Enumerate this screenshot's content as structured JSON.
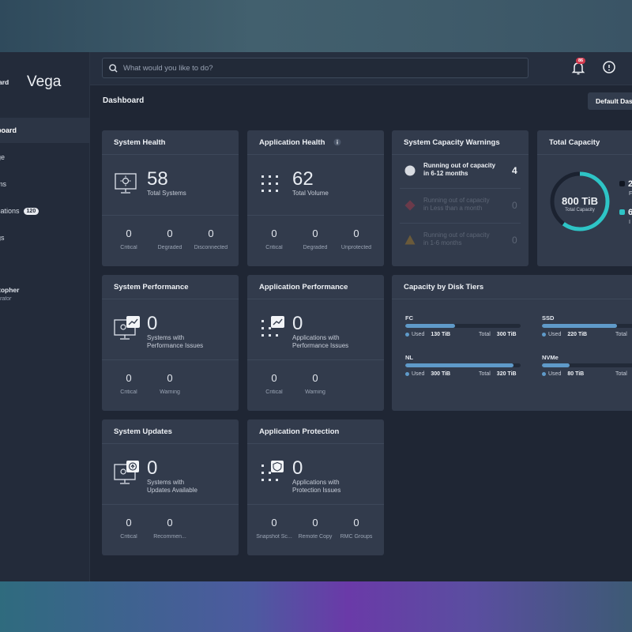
{
  "sidebar": {
    "brand_small": "ard",
    "brand": "Vega",
    "items": [
      {
        "label": "board",
        "active": true
      },
      {
        "label": "ge"
      },
      {
        "label": "ms"
      },
      {
        "label": "cations",
        "badge": "120"
      },
      {
        "label": "gs"
      }
    ],
    "user": {
      "name": "topher",
      "role": "trator"
    }
  },
  "topbar": {
    "search_placeholder": "What would you like to do?",
    "notification_count": "86"
  },
  "dashboard": {
    "title": "Dashboard",
    "default_button": "Default Das"
  },
  "cards": {
    "system_health": {
      "title": "System Health",
      "value": "58",
      "sub": "Total Systems",
      "stats": [
        {
          "v": "0",
          "l": "Critical"
        },
        {
          "v": "0",
          "l": "Degraded"
        },
        {
          "v": "0",
          "l": "Disconnected"
        }
      ]
    },
    "application_health": {
      "title": "Application Health",
      "value": "62",
      "sub": "Total Volume",
      "stats": [
        {
          "v": "0",
          "l": "Critical"
        },
        {
          "v": "0",
          "l": "Degraded"
        },
        {
          "v": "0",
          "l": "Unprotected"
        }
      ]
    },
    "capacity_warnings": {
      "title": "System Capacity Warnings",
      "rows": [
        {
          "line1": "Running out of capacity",
          "line2": "in 6-12 months",
          "count": "4"
        },
        {
          "line1": "Running out of capacity",
          "line2": "in Less than a month",
          "count": "0"
        },
        {
          "line1": "Running out of capacity",
          "line2": "in 1-6 months",
          "count": "0"
        }
      ]
    },
    "total_capacity": {
      "title": "Total Capacity",
      "value": "800 TiB",
      "sub": "Total Capacity",
      "used_fraction": 0.6,
      "legend": [
        {
          "value": "2",
          "label": "F"
        },
        {
          "value": "6",
          "label": "I"
        }
      ],
      "colors": {
        "used": "#2ec4c6",
        "free": "#1b2230"
      }
    },
    "system_performance": {
      "title": "System Performance",
      "value": "0",
      "sub1": "Systems with",
      "sub2": "Performance Issues",
      "stats": [
        {
          "v": "0",
          "l": "Critical"
        },
        {
          "v": "0",
          "l": "Warning"
        }
      ]
    },
    "application_performance": {
      "title": "Application Performance",
      "value": "0",
      "sub1": "Applications with",
      "sub2": "Performance Issues",
      "stats": [
        {
          "v": "0",
          "l": "Critical"
        },
        {
          "v": "0",
          "l": "Warning"
        }
      ]
    },
    "disk_tiers": {
      "title": "Capacity by Disk Tiers",
      "tiers": [
        {
          "name": "FC",
          "used": "130 TiB",
          "total": "300 TiB",
          "fraction": 0.43
        },
        {
          "name": "SSD",
          "used": "220 TiB",
          "total": "",
          "fraction": 0.73
        },
        {
          "name": "NL",
          "used": "300 TiB",
          "total": "320 TiB",
          "fraction": 0.94
        },
        {
          "name": "NVMe",
          "used": "80 TiB",
          "total": "",
          "fraction": 0.27
        }
      ],
      "used_label": "Used",
      "total_label": "Total"
    },
    "system_updates": {
      "title": "System Updates",
      "value": "0",
      "sub1": "Systems with",
      "sub2": "Updates Available",
      "stats": [
        {
          "v": "0",
          "l": "Critical"
        },
        {
          "v": "0",
          "l": "Recommen..."
        }
      ]
    },
    "application_protection": {
      "title": "Application Protection",
      "value": "0",
      "sub1": "Applications with",
      "sub2": "Protection Issues",
      "stats": [
        {
          "v": "0",
          "l": "Snapshot Sc..."
        },
        {
          "v": "0",
          "l": "Remote Copy"
        },
        {
          "v": "0",
          "l": "RMC Groups"
        }
      ]
    }
  }
}
